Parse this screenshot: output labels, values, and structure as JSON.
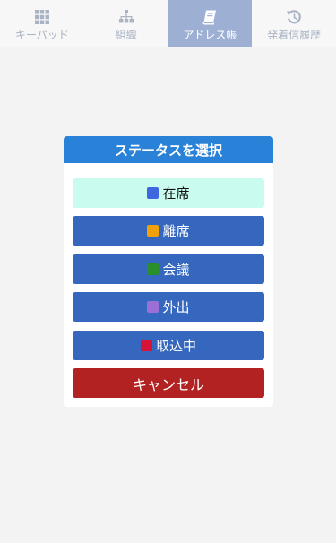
{
  "tabs": [
    {
      "label": "キーパッド",
      "icon": "keypad-grid-icon",
      "active": false
    },
    {
      "label": "組織",
      "icon": "org-chart-icon",
      "active": false
    },
    {
      "label": "アドレス帳",
      "icon": "address-book-icon",
      "active": true
    },
    {
      "label": "発着信履歴",
      "icon": "history-icon",
      "active": false
    }
  ],
  "dialog": {
    "title": "ステータスを選択",
    "statuses": [
      {
        "label": "在席",
        "color": "#3f67e0",
        "selected": true
      },
      {
        "label": "離席",
        "color": "#f2a10b",
        "selected": false
      },
      {
        "label": "会議",
        "color": "#2a8f2a",
        "selected": false
      },
      {
        "label": "外出",
        "color": "#9a6fd6",
        "selected": false
      },
      {
        "label": "取込中",
        "color": "#d8133a",
        "selected": false
      }
    ],
    "cancel_label": "キャンセル"
  },
  "colors": {
    "header": "#2a82d8",
    "button": "#3467bd",
    "selected": "#c9fcef",
    "cancel": "#b32222",
    "active_tab": "#9db0d4"
  }
}
